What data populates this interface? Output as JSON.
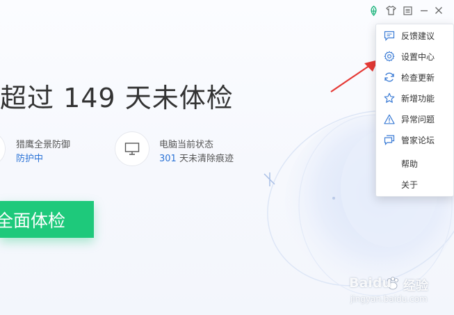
{
  "titlebar": {
    "icons": [
      "skin-leaf-icon",
      "shirt-icon",
      "menu-icon",
      "minimize-icon",
      "close-icon"
    ]
  },
  "headline": "超过 149 天未体检",
  "status": [
    {
      "label": "猎鹰全景防御",
      "value": "防护中",
      "value_color": "#2a72d6"
    },
    {
      "label": "电脑当前状态",
      "value_num": "301",
      "value_text": " 天未清除痕迹",
      "value_color": "#2a72d6"
    }
  ],
  "scan_button": "全面体检",
  "menu": {
    "items": [
      {
        "label": "反馈建议",
        "icon": "feedback-icon"
      },
      {
        "label": "设置中心",
        "icon": "settings-gear-icon"
      },
      {
        "label": "检查更新",
        "icon": "refresh-icon"
      },
      {
        "label": "新增功能",
        "icon": "star-icon"
      },
      {
        "label": "异常问题",
        "icon": "warning-icon"
      },
      {
        "label": "管家论坛",
        "icon": "forum-icon"
      },
      {
        "label": "帮助",
        "icon": ""
      },
      {
        "label": "关于",
        "icon": ""
      }
    ]
  },
  "watermark": {
    "brand": "Baidu",
    "suffix": "经验",
    "url": "jingyan.baidu.com"
  },
  "colors": {
    "accent_green": "#1ec97b",
    "link_blue": "#2a72d6",
    "arrow_red": "#e53935",
    "icon_blue": "#3a7bd5"
  }
}
